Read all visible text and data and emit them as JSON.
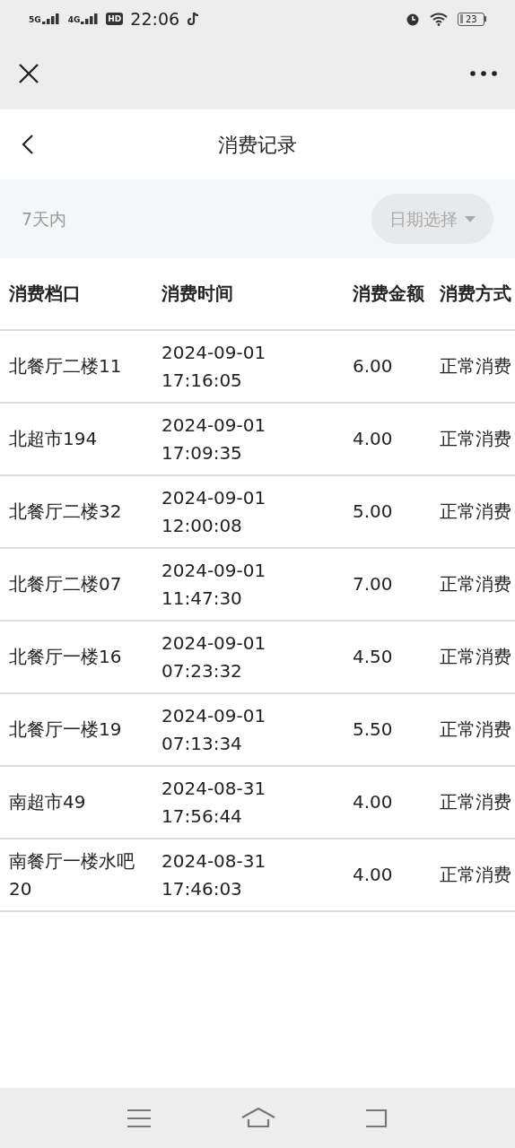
{
  "status_bar": {
    "network_1": "5G",
    "network_2": "4G",
    "hd": "HD",
    "time": "22:06",
    "battery": "23"
  },
  "page": {
    "title": "消费记录"
  },
  "filter": {
    "range": "7天内",
    "date_picker": "日期选择"
  },
  "table": {
    "columns": [
      "消费档口",
      "消费时间",
      "消费金额",
      "消费方式"
    ],
    "rows": [
      {
        "stall": "北餐厅二楼11",
        "time": "2024-09-01 17:16:05",
        "amount": "6.00",
        "method": "正常消费"
      },
      {
        "stall": "北超市194",
        "time": "2024-09-01 17:09:35",
        "amount": "4.00",
        "method": "正常消费"
      },
      {
        "stall": "北餐厅二楼32",
        "time": "2024-09-01 12:00:08",
        "amount": "5.00",
        "method": "正常消费"
      },
      {
        "stall": "北餐厅二楼07",
        "time": "2024-09-01 11:47:30",
        "amount": "7.00",
        "method": "正常消费"
      },
      {
        "stall": "北餐厅一楼16",
        "time": "2024-09-01 07:23:32",
        "amount": "4.50",
        "method": "正常消费"
      },
      {
        "stall": "北餐厅一楼19",
        "time": "2024-09-01 07:13:34",
        "amount": "5.50",
        "method": "正常消费"
      },
      {
        "stall": "南超市49",
        "time": "2024-08-31 17:56:44",
        "amount": "4.00",
        "method": "正常消费"
      },
      {
        "stall": "南餐厅一楼水吧20",
        "time": "2024-08-31 17:46:03",
        "amount": "4.00",
        "method": "正常消费"
      }
    ]
  }
}
